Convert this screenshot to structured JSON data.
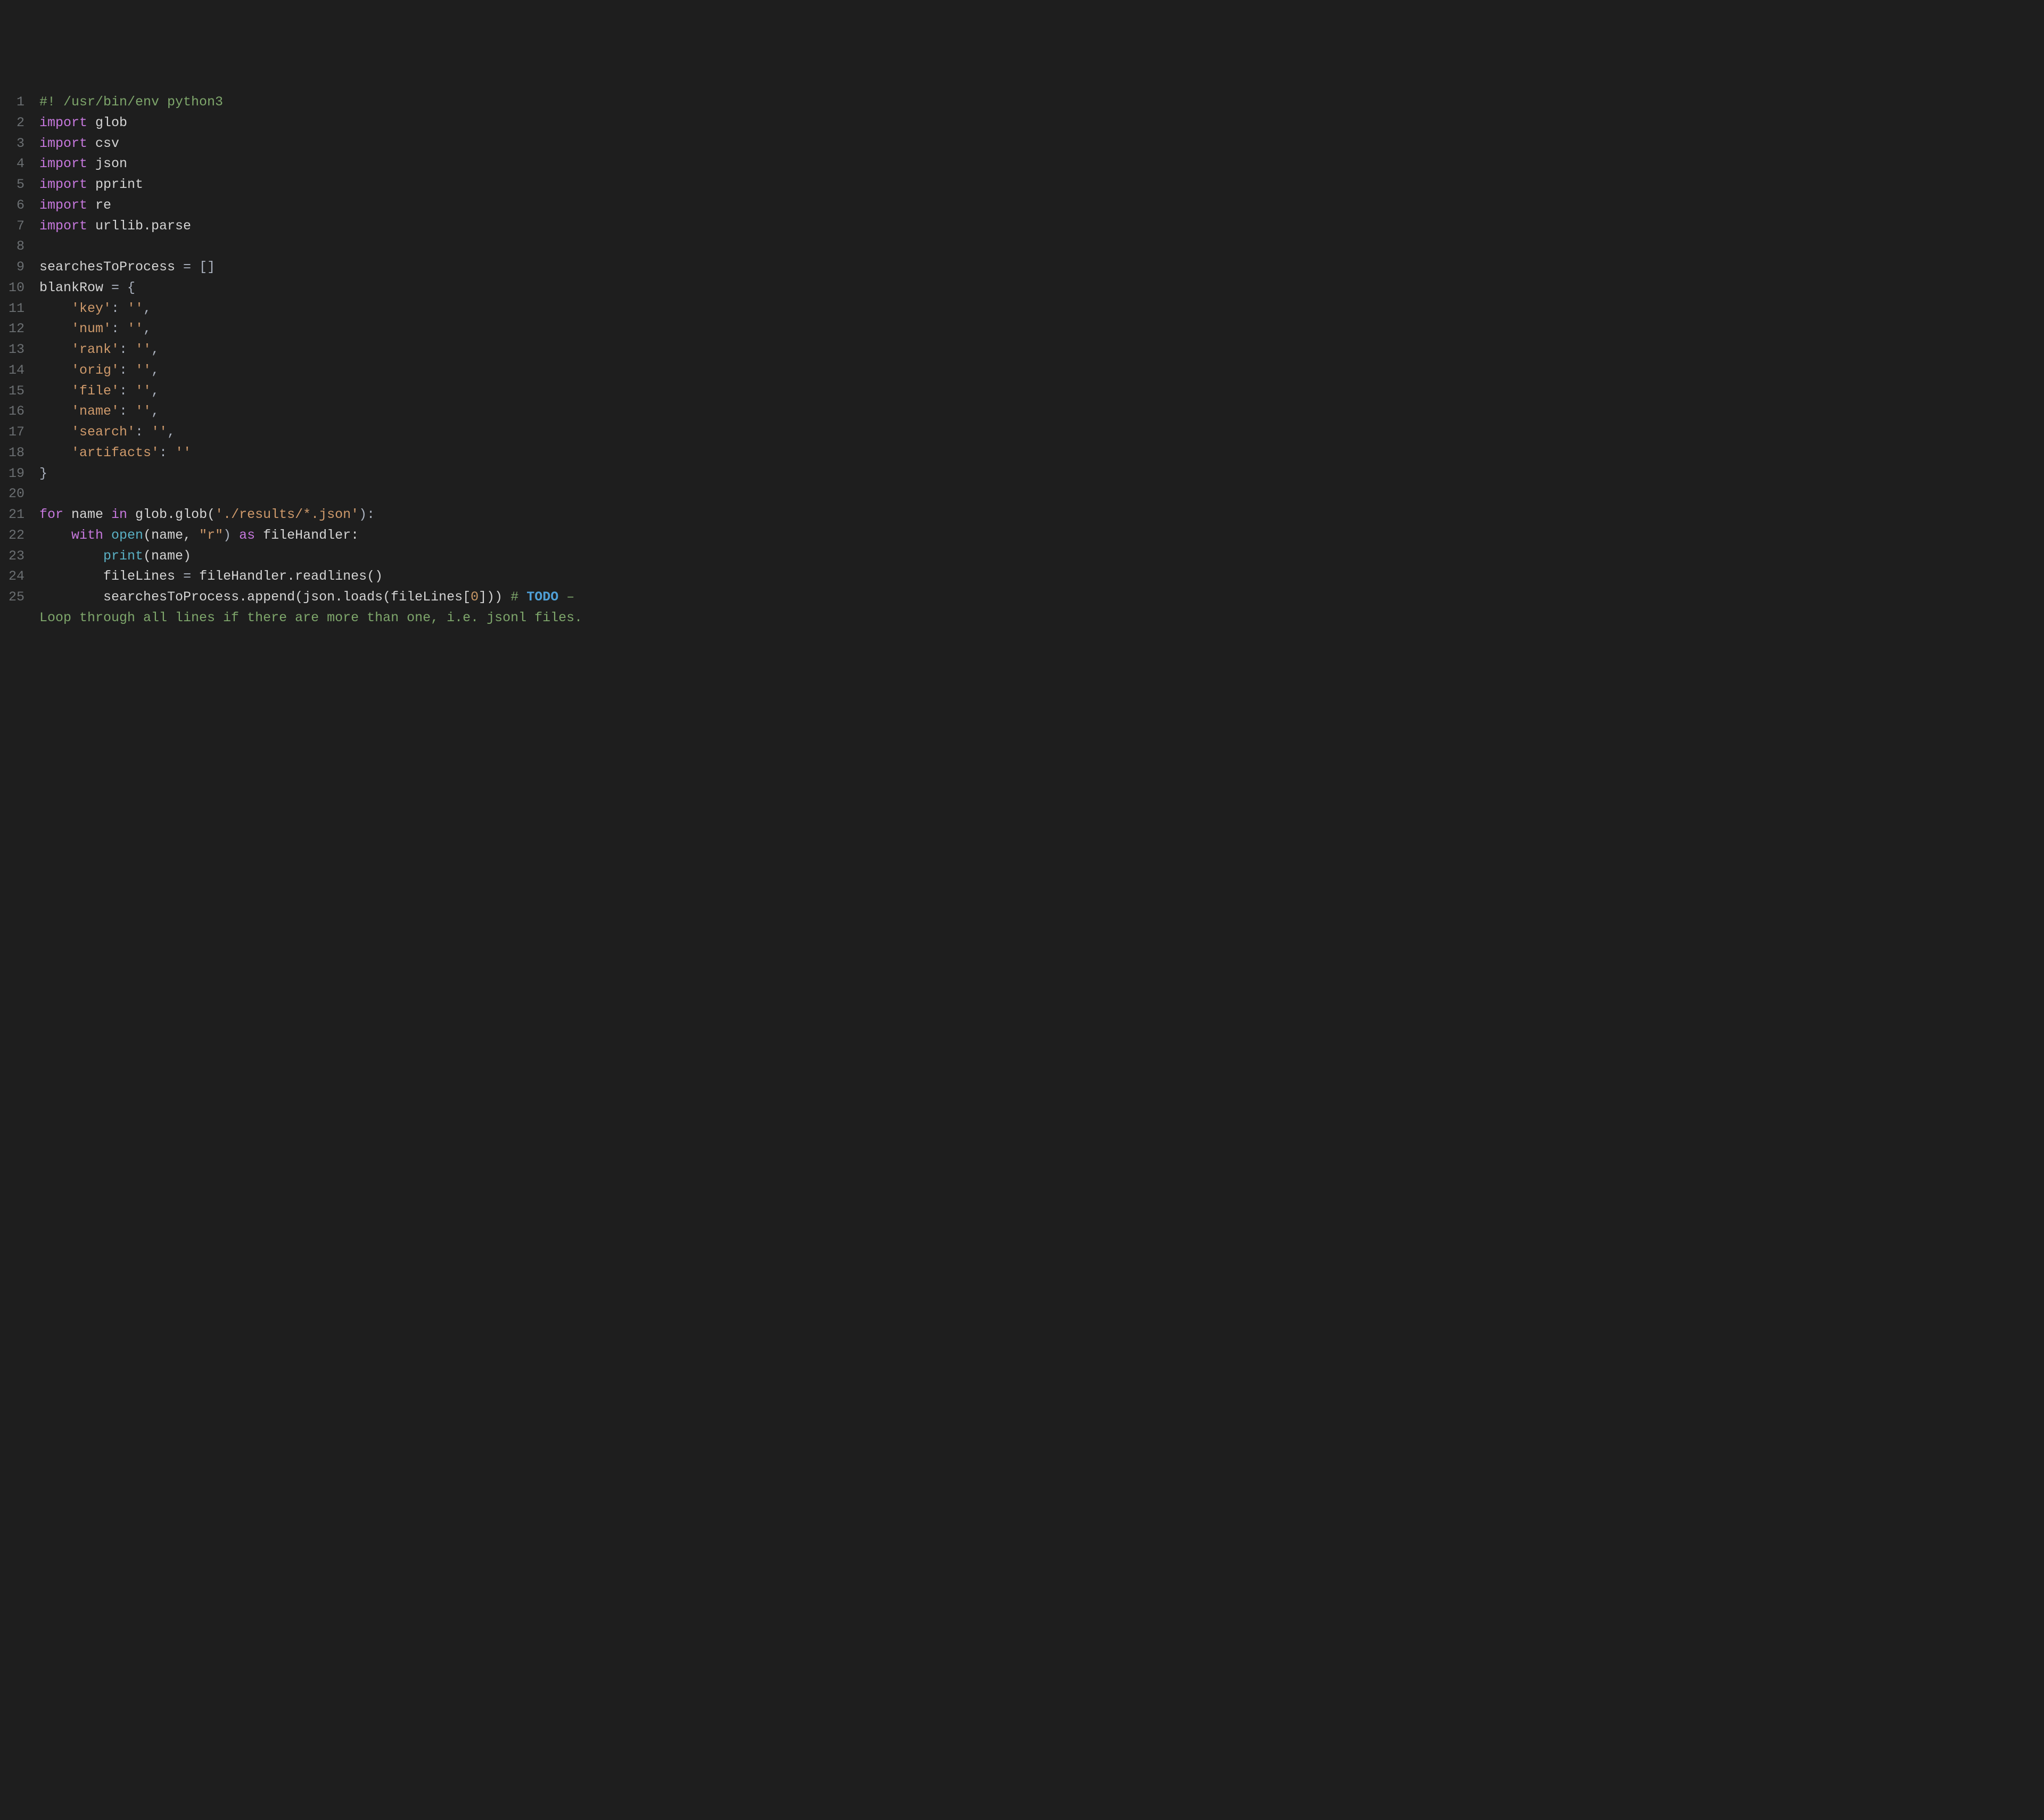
{
  "editor": {
    "language": "python",
    "lines": [
      {
        "num": "1",
        "tokens": [
          {
            "t": "#! /usr/bin/env python3",
            "c": "shebang"
          }
        ]
      },
      {
        "num": "2",
        "tokens": [
          {
            "t": "import",
            "c": "keyword"
          },
          {
            "t": " glob",
            "c": "ident"
          }
        ]
      },
      {
        "num": "3",
        "tokens": [
          {
            "t": "import",
            "c": "keyword"
          },
          {
            "t": " csv",
            "c": "ident"
          }
        ]
      },
      {
        "num": "4",
        "tokens": [
          {
            "t": "import",
            "c": "keyword"
          },
          {
            "t": " json",
            "c": "ident"
          }
        ]
      },
      {
        "num": "5",
        "tokens": [
          {
            "t": "import",
            "c": "keyword"
          },
          {
            "t": " pprint",
            "c": "ident"
          }
        ]
      },
      {
        "num": "6",
        "tokens": [
          {
            "t": "import",
            "c": "keyword"
          },
          {
            "t": " re",
            "c": "ident"
          }
        ]
      },
      {
        "num": "7",
        "tokens": [
          {
            "t": "import",
            "c": "keyword"
          },
          {
            "t": " urllib.parse",
            "c": "ident"
          }
        ]
      },
      {
        "num": "8",
        "tokens": [
          {
            "t": "",
            "c": "ident"
          }
        ]
      },
      {
        "num": "9",
        "tokens": [
          {
            "t": "searchesToProcess ",
            "c": "ident"
          },
          {
            "t": "=",
            "c": "punct"
          },
          {
            "t": " []",
            "c": "punct"
          }
        ]
      },
      {
        "num": "10",
        "tokens": [
          {
            "t": "blankRow ",
            "c": "ident"
          },
          {
            "t": "=",
            "c": "punct"
          },
          {
            "t": " {",
            "c": "punct"
          }
        ]
      },
      {
        "num": "11",
        "tokens": [
          {
            "t": "    ",
            "c": "ident"
          },
          {
            "t": "'key'",
            "c": "string"
          },
          {
            "t": ": ",
            "c": "punct"
          },
          {
            "t": "''",
            "c": "string"
          },
          {
            "t": ",",
            "c": "punct"
          }
        ]
      },
      {
        "num": "12",
        "tokens": [
          {
            "t": "    ",
            "c": "ident"
          },
          {
            "t": "'num'",
            "c": "string"
          },
          {
            "t": ": ",
            "c": "punct"
          },
          {
            "t": "''",
            "c": "string"
          },
          {
            "t": ",",
            "c": "punct"
          }
        ]
      },
      {
        "num": "13",
        "tokens": [
          {
            "t": "    ",
            "c": "ident"
          },
          {
            "t": "'rank'",
            "c": "string"
          },
          {
            "t": ": ",
            "c": "punct"
          },
          {
            "t": "''",
            "c": "string"
          },
          {
            "t": ",",
            "c": "punct"
          }
        ]
      },
      {
        "num": "14",
        "tokens": [
          {
            "t": "    ",
            "c": "ident"
          },
          {
            "t": "'orig'",
            "c": "string"
          },
          {
            "t": ": ",
            "c": "punct"
          },
          {
            "t": "''",
            "c": "string"
          },
          {
            "t": ",",
            "c": "punct"
          }
        ]
      },
      {
        "num": "15",
        "tokens": [
          {
            "t": "    ",
            "c": "ident"
          },
          {
            "t": "'file'",
            "c": "string"
          },
          {
            "t": ": ",
            "c": "punct"
          },
          {
            "t": "''",
            "c": "string"
          },
          {
            "t": ",",
            "c": "punct"
          }
        ]
      },
      {
        "num": "16",
        "tokens": [
          {
            "t": "    ",
            "c": "ident"
          },
          {
            "t": "'name'",
            "c": "string"
          },
          {
            "t": ": ",
            "c": "punct"
          },
          {
            "t": "''",
            "c": "string"
          },
          {
            "t": ",",
            "c": "punct"
          }
        ]
      },
      {
        "num": "17",
        "tokens": [
          {
            "t": "    ",
            "c": "ident"
          },
          {
            "t": "'search'",
            "c": "string"
          },
          {
            "t": ": ",
            "c": "punct"
          },
          {
            "t": "''",
            "c": "string"
          },
          {
            "t": ",",
            "c": "punct"
          }
        ]
      },
      {
        "num": "18",
        "tokens": [
          {
            "t": "    ",
            "c": "ident"
          },
          {
            "t": "'artifacts'",
            "c": "string"
          },
          {
            "t": ": ",
            "c": "punct"
          },
          {
            "t": "''",
            "c": "string"
          }
        ]
      },
      {
        "num": "19",
        "tokens": [
          {
            "t": "}",
            "c": "punct"
          }
        ]
      },
      {
        "num": "20",
        "tokens": [
          {
            "t": "",
            "c": "ident"
          }
        ]
      },
      {
        "num": "21",
        "tokens": [
          {
            "t": "for",
            "c": "keyword"
          },
          {
            "t": " name ",
            "c": "ident"
          },
          {
            "t": "in",
            "c": "keyword"
          },
          {
            "t": " glob.glob(",
            "c": "ident"
          },
          {
            "t": "'./results/*.json'",
            "c": "string"
          },
          {
            "t": "):",
            "c": "punct"
          }
        ]
      },
      {
        "num": "22",
        "tokens": [
          {
            "t": "    ",
            "c": "ident"
          },
          {
            "t": "with",
            "c": "keyword"
          },
          {
            "t": " ",
            "c": "ident"
          },
          {
            "t": "open",
            "c": "builtin"
          },
          {
            "t": "(name, ",
            "c": "ident"
          },
          {
            "t": "\"r\"",
            "c": "string"
          },
          {
            "t": ") ",
            "c": "punct"
          },
          {
            "t": "as",
            "c": "keyword"
          },
          {
            "t": " fileHandler:",
            "c": "ident"
          }
        ]
      },
      {
        "num": "23",
        "tokens": [
          {
            "t": "        ",
            "c": "ident"
          },
          {
            "t": "print",
            "c": "builtin"
          },
          {
            "t": "(name)",
            "c": "ident"
          }
        ]
      },
      {
        "num": "24",
        "tokens": [
          {
            "t": "        fileLines ",
            "c": "ident"
          },
          {
            "t": "=",
            "c": "punct"
          },
          {
            "t": " fileHandler.readlines()",
            "c": "ident"
          }
        ]
      },
      {
        "num": "25",
        "tokens": [
          {
            "t": "        searchesToProcess.append(json.loads(fileLines[",
            "c": "ident"
          },
          {
            "t": "0",
            "c": "number"
          },
          {
            "t": "])) ",
            "c": "ident"
          },
          {
            "t": "# ",
            "c": "comment"
          },
          {
            "t": "TODO",
            "c": "todo"
          },
          {
            "t": " – ",
            "c": "comment"
          }
        ]
      },
      {
        "continuation": true,
        "tokens": [
          {
            "t": "Loop through all lines if there are more than one, i.e. jsonl files.",
            "c": "comment"
          }
        ]
      }
    ]
  }
}
